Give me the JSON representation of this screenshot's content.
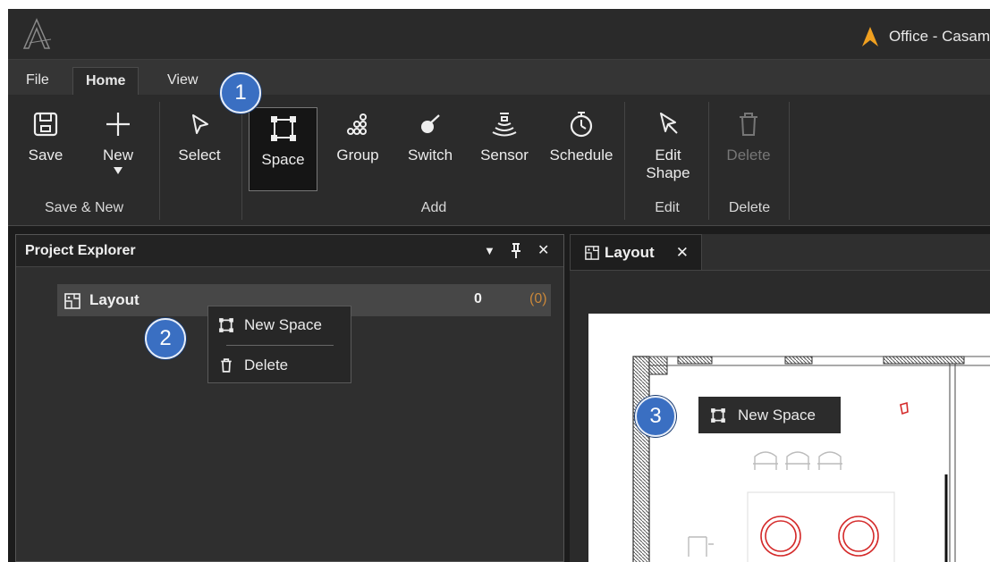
{
  "app": {
    "title": "Office - Casam",
    "logo_icon": "app-logo-icon",
    "accent_color": "#f0a020"
  },
  "tabs": [
    {
      "label": "File",
      "active": false
    },
    {
      "label": "Home",
      "active": true
    },
    {
      "label": "View",
      "active": false
    }
  ],
  "ribbon": {
    "buttons": {
      "save": {
        "label": "Save",
        "icon": "save-icon"
      },
      "new": {
        "label": "New",
        "icon": "plus-icon"
      },
      "select": {
        "label": "Select",
        "icon": "cursor-icon"
      },
      "space": {
        "label": "Space",
        "icon": "space-icon",
        "selected": true
      },
      "group": {
        "label": "Group",
        "icon": "group-icon"
      },
      "switch": {
        "label": "Switch",
        "icon": "switch-icon"
      },
      "sensor": {
        "label": "Sensor",
        "icon": "sensor-icon"
      },
      "schedule": {
        "label": "Schedule",
        "icon": "stopwatch-icon"
      },
      "edit_shape_line1": {
        "label": "Edit",
        "icon": "edit-shape-icon"
      },
      "edit_shape_line2": {
        "label": "Shape"
      },
      "delete": {
        "label": "Delete",
        "icon": "trash-icon",
        "disabled": true
      }
    },
    "groups": {
      "save_new": "Save & New",
      "add": "Add",
      "edit": "Edit",
      "delete": "Delete"
    }
  },
  "explorer": {
    "title": "Project Explorer",
    "controls": {
      "dropdown": "▼",
      "pin": "📌",
      "close": "✕"
    },
    "item": {
      "label": "Layout",
      "count": "0",
      "sub_count": "(0)",
      "icon": "layout-icon"
    }
  },
  "context_menu": {
    "items": [
      {
        "label": "New Space",
        "icon": "space-icon"
      },
      {
        "label": "Delete",
        "icon": "trash-icon"
      }
    ]
  },
  "document": {
    "tab_label": "Layout",
    "tab_close": "✕",
    "tooltip": {
      "label": "New Space",
      "icon": "space-icon"
    }
  },
  "callouts": [
    "1",
    "2",
    "3"
  ],
  "colors": {
    "callout": "#3a6fc2",
    "subcount": "#c9873a",
    "sensor_red": "#d42a2a"
  }
}
